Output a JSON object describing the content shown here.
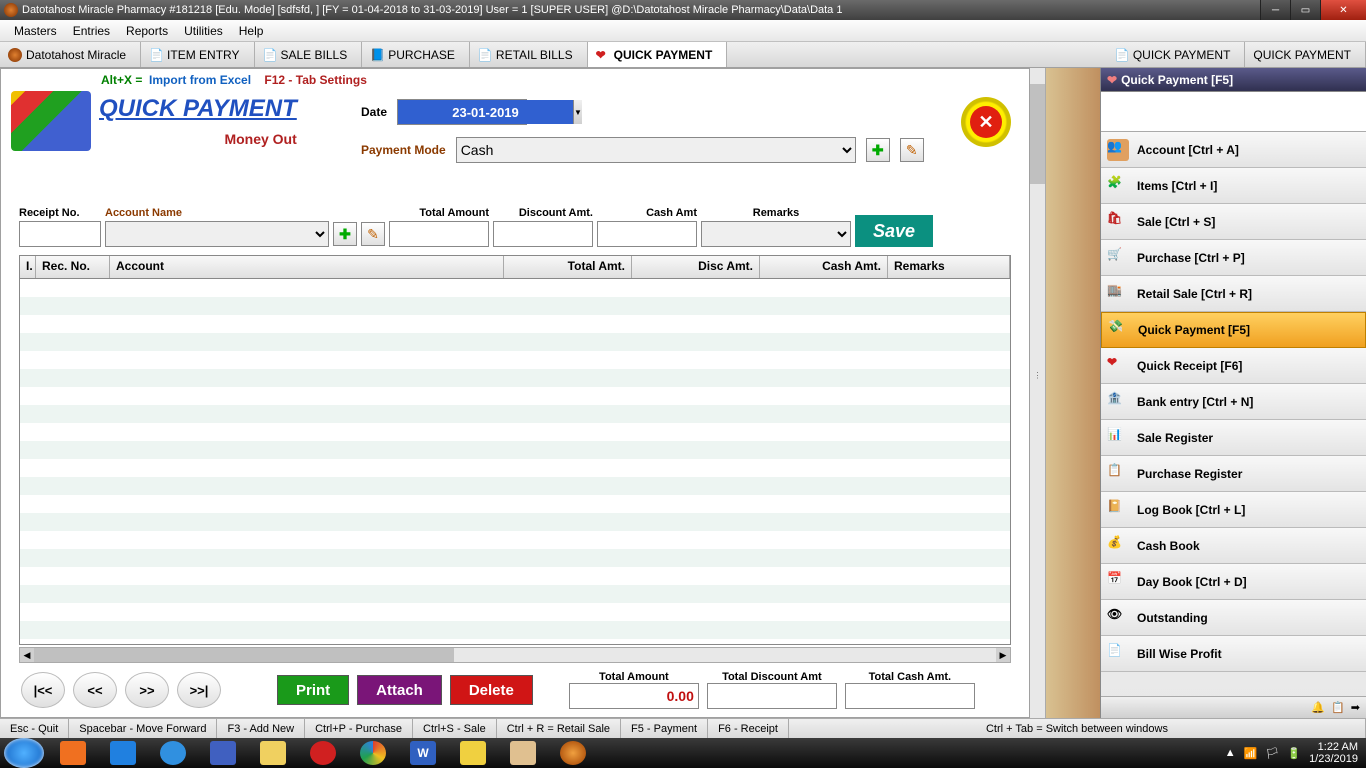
{
  "titlebar": "Datotahost Miracle Pharmacy #181218  [Edu. Mode]  [sdfsfd, ] [FY = 01-04-2018 to 31-03-2019] User = 1 [SUPER USER]  @D:\\Datotahost Miracle Pharmacy\\Data\\Data 1",
  "menu": {
    "masters": "Masters",
    "entries": "Entries",
    "reports": "Reports",
    "utilities": "Utilities",
    "help": "Help"
  },
  "tabs": {
    "t0": "Datotahost Miracle",
    "t1": "ITEM ENTRY",
    "t2": "SALE BILLS",
    "t3": "PURCHASE",
    "t4": "RETAIL BILLS",
    "t5": "QUICK PAYMENT",
    "t6": "QUICK PAYMENT",
    "t7": "QUICK PAYMENT"
  },
  "shortcuts": {
    "a": "Alt+X =",
    "b": "Import from Excel",
    "c": "F12 - Tab Settings"
  },
  "page": {
    "title": "QUICK PAYMENT",
    "subtitle": "Money Out"
  },
  "form": {
    "date_lbl": "Date",
    "date_val": "23-01-2019",
    "pmode_lbl": "Payment Mode",
    "pmode_val": "Cash",
    "receipt_lbl": "Receipt No.",
    "account_lbl": "Account Name",
    "total_lbl": "Total Amount",
    "disc_lbl": "Discount Amt.",
    "cash_lbl": "Cash Amt",
    "remarks_lbl": "Remarks",
    "save": "Save"
  },
  "grid": {
    "c0": "I.",
    "c1": "Rec. No.",
    "c2": "Account",
    "c3": "Total Amt.",
    "c4": "Disc Amt.",
    "c5": "Cash Amt.",
    "c6": "Remarks"
  },
  "bottom": {
    "first": "|<<",
    "prev": "<<",
    "next": ">>",
    "last": ">>|",
    "print": "Print",
    "attach": "Attach",
    "delete": "Delete",
    "tot1_lbl": "Total Amount",
    "tot1_val": "0.00",
    "tot2_lbl": "Total Discount Amt",
    "tot2_val": "",
    "tot3_lbl": "Total Cash Amt.",
    "tot3_val": ""
  },
  "right": {
    "header": "Quick Payment [F5]",
    "i0": "Account [Ctrl + A]",
    "i1": "Items [Ctrl + I]",
    "i2": "Sale [Ctrl + S]",
    "i3": "Purchase [Ctrl + P]",
    "i4": "Retail Sale [Ctrl + R]",
    "i5": "Quick Payment [F5]",
    "i6": "Quick Receipt [F6]",
    "i7": "Bank entry [Ctrl + N]",
    "i8": "Sale Register",
    "i9": "Purchase Register",
    "i10": "Log Book [Ctrl + L]",
    "i11": "Cash Book",
    "i12": "Day Book [Ctrl + D]",
    "i13": "Outstanding",
    "i14": "Bill Wise Profit"
  },
  "status": {
    "s0": "Esc - Quit",
    "s1": "Spacebar - Move Forward",
    "s2": "F3 - Add New",
    "s3": "Ctrl+P - Purchase",
    "s4": "Ctrl+S - Sale",
    "s5": "Ctrl + R = Retail Sale",
    "s6": "F5 - Payment",
    "s7": "F6 - Receipt",
    "s8": "Ctrl + Tab = Switch between windows"
  },
  "tray": {
    "time": "1:22 AM",
    "date": "1/23/2019"
  }
}
